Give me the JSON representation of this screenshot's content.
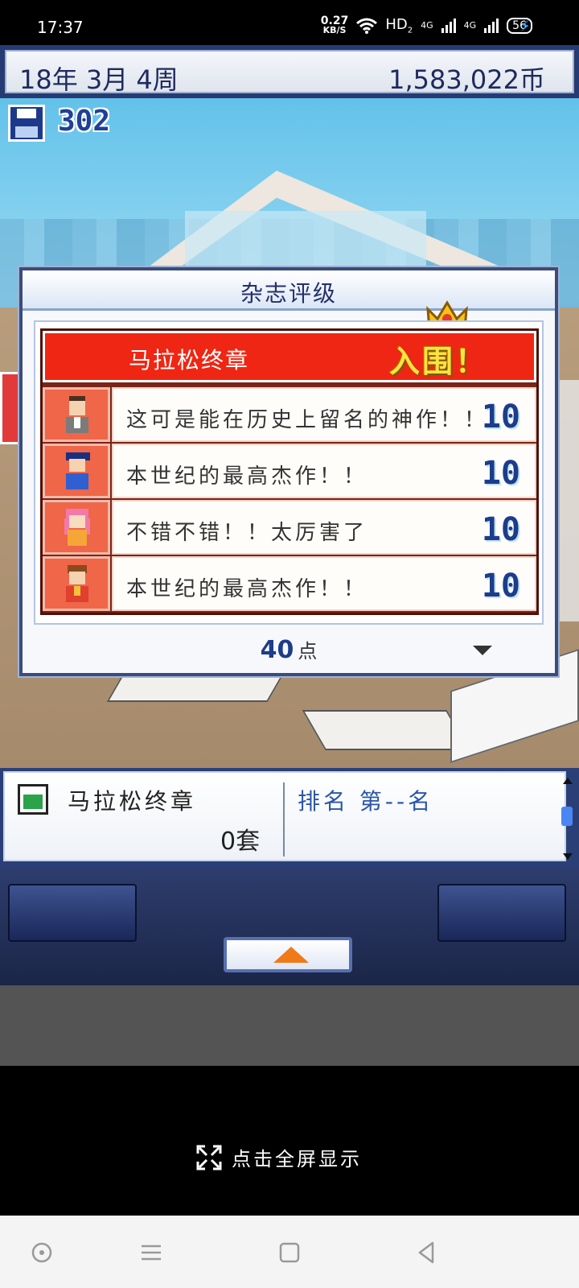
{
  "status_bar": {
    "time": "17:37",
    "net_speed_value": "0.27",
    "net_speed_unit": "KB/S",
    "hd": "HD",
    "hd_sub": "2",
    "sig1": "4G",
    "sig2": "4G",
    "battery": "56"
  },
  "header": {
    "date": "18年 3月 4周",
    "money": "1,583,022币"
  },
  "save": {
    "count": "302"
  },
  "dialog": {
    "title": "杂志评级",
    "game_name": "马拉松终章",
    "result": "入围！",
    "reviews": [
      {
        "avatar": "reviewer-1",
        "comment": "这可是能在历史上留名的神作！！",
        "score": "10"
      },
      {
        "avatar": "reviewer-2",
        "comment": "本世纪的最高杰作！！",
        "score": "10"
      },
      {
        "avatar": "reviewer-3",
        "comment": "不错不错！！太厉害了",
        "score": "10"
      },
      {
        "avatar": "reviewer-4",
        "comment": "本世纪的最高杰作！！",
        "score": "10"
      }
    ],
    "total_value": "40",
    "total_unit": "点"
  },
  "info_panel": {
    "game_name": "马拉松终章",
    "sales": "0套",
    "rank": "排名 第--名"
  },
  "fullscreen_label": "点击全屏显示",
  "colors": {
    "accent_red": "#ef2613",
    "navy": "#263a73",
    "score_blue": "#1d3c8a"
  }
}
